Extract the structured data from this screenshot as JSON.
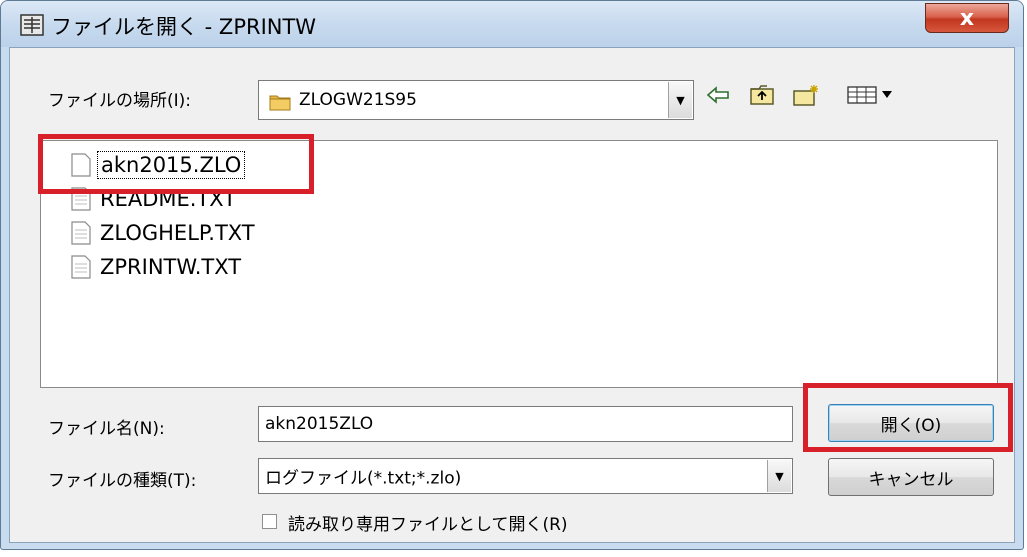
{
  "window": {
    "title": "ファイルを開く - ZPRINTW",
    "close_glyph": "x"
  },
  "look_in": {
    "label": "ファイルの場所(I):",
    "value": "ZLOGW21S95",
    "icons": [
      "back-arrow-icon",
      "up-folder-icon",
      "new-folder-icon",
      "view-menu-icon"
    ]
  },
  "files": [
    {
      "name": "akn2015.ZLO",
      "selected": true
    },
    {
      "name": "README.TXT",
      "selected": false
    },
    {
      "name": "ZLOGHELP.TXT",
      "selected": false
    },
    {
      "name": "ZPRINTW.TXT",
      "selected": false
    }
  ],
  "filename": {
    "label": "ファイル名(N):",
    "value": "akn2015ZLO"
  },
  "filetype": {
    "label": "ファイルの種類(T):",
    "value": "ログファイル(*.txt;*.zlo)"
  },
  "readonly": {
    "label": "読み取り専用ファイルとして開く(R)",
    "checked": false
  },
  "buttons": {
    "open": "開く(O)",
    "cancel": "キャンセル"
  },
  "colors": {
    "highlight": "#d8202a",
    "title_bar": "#c6d9ee",
    "close_button": "#c2361f"
  }
}
